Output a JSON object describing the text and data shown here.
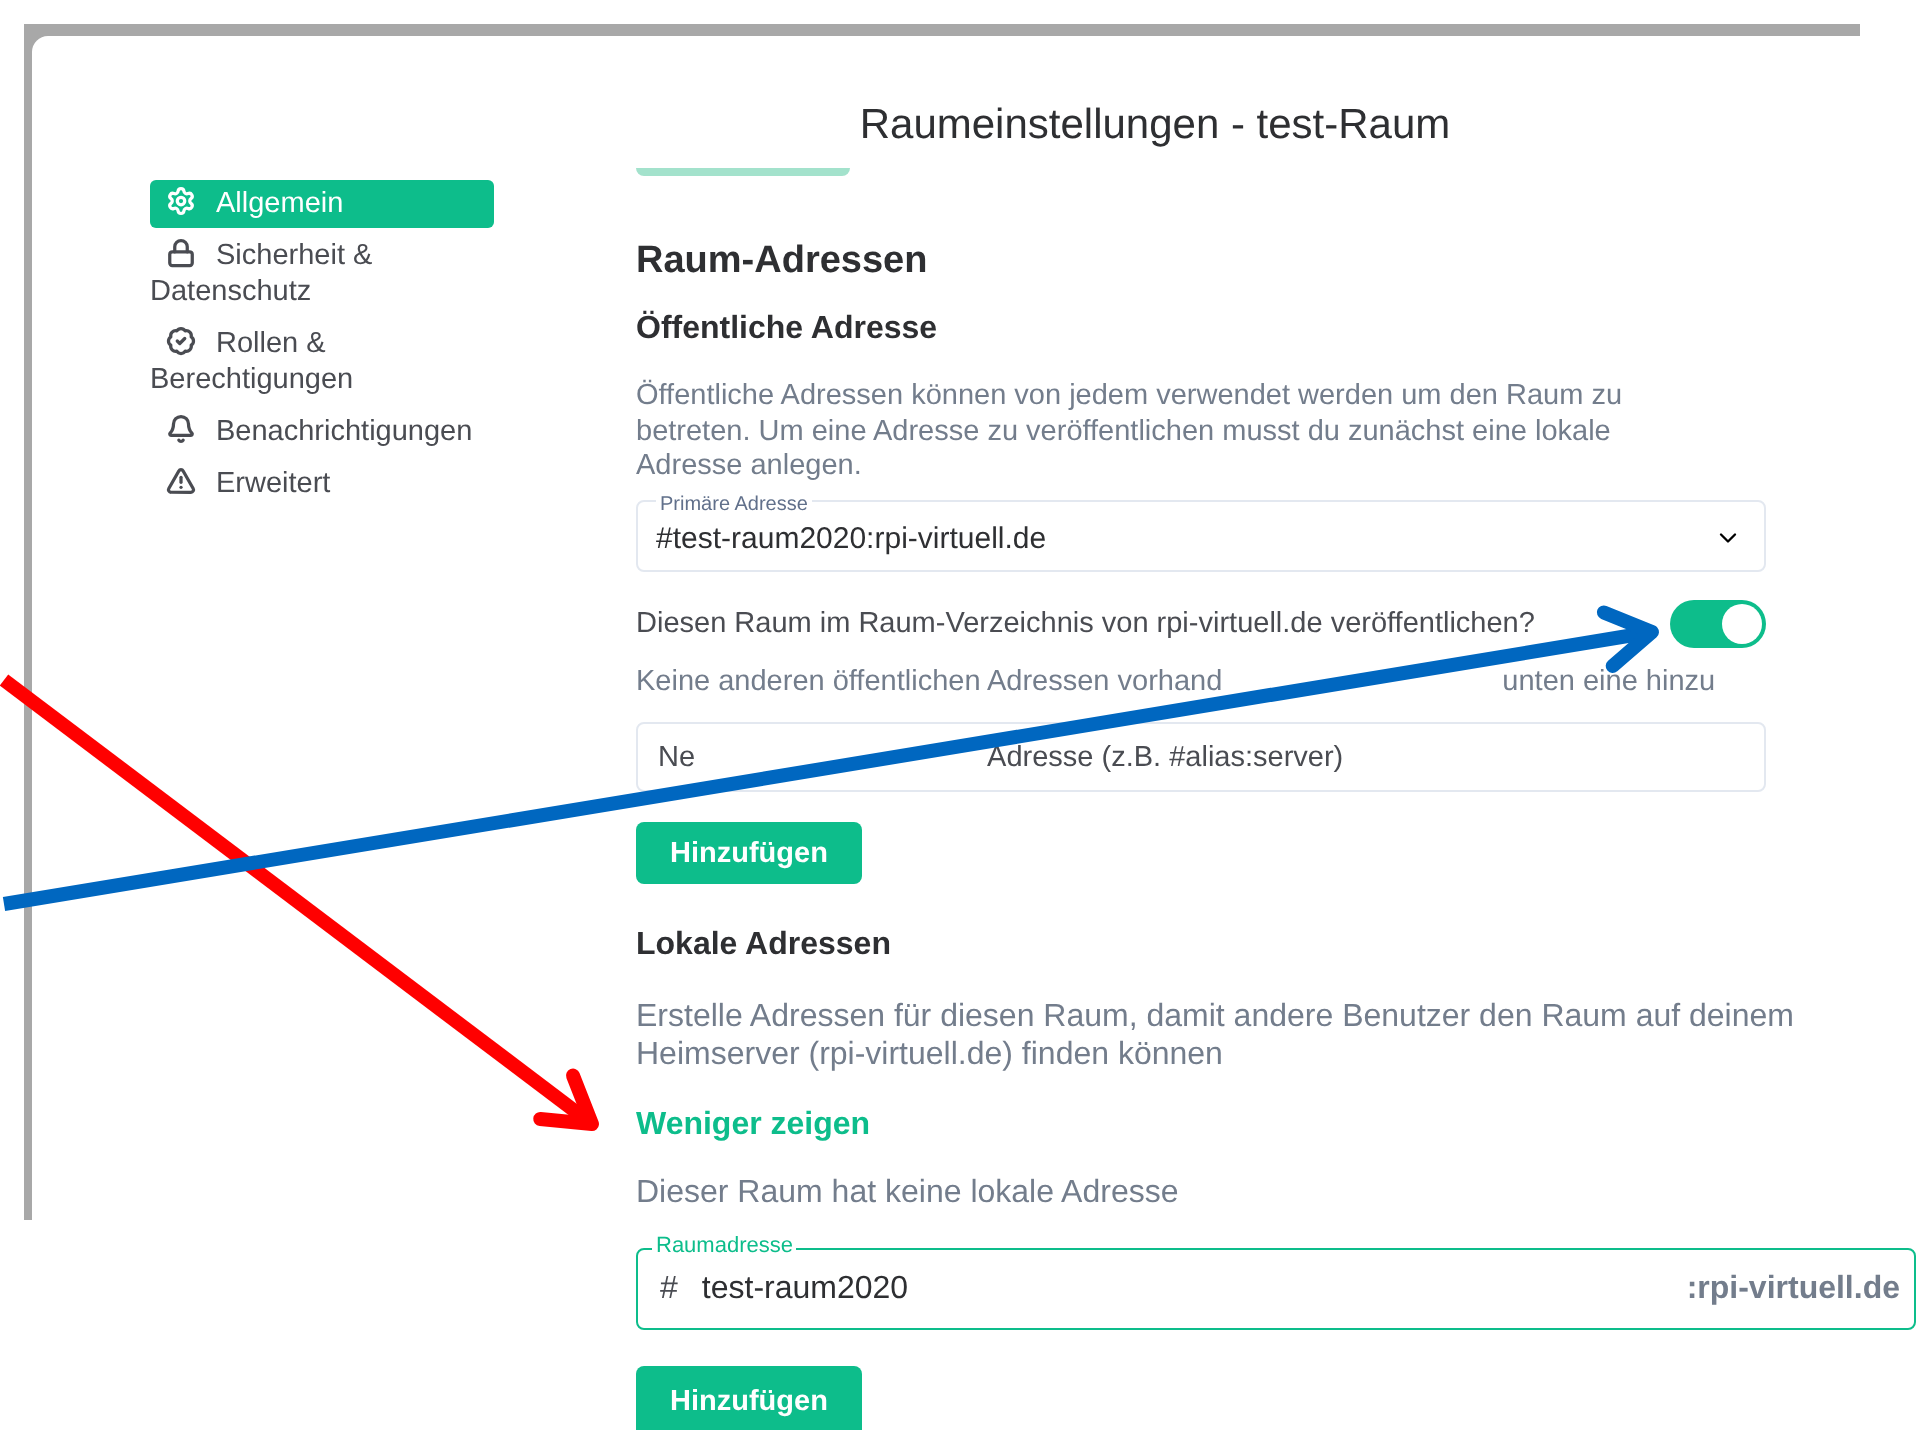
{
  "dialog": {
    "title": "Raumeinstellungen - test-Raum"
  },
  "sidebar": {
    "items": [
      {
        "label": "Allgemein",
        "selected": true
      },
      {
        "label": "Sicherheit & Datenschutz",
        "selected": false
      },
      {
        "label": "Rollen & Berechtigungen",
        "selected": false
      },
      {
        "label": "Benachrichtigungen",
        "selected": false
      },
      {
        "label": "Erweitert",
        "selected": false
      }
    ]
  },
  "section_title": "Raum-Adressen",
  "public": {
    "heading": "Öffentliche Adresse",
    "description": "Öffentliche Adressen können von jedem verwendet werden um den Raum zu betreten. Um eine Adresse zu veröffentlichen musst du zunächst eine lokale Adresse anlegen.",
    "primary_select": {
      "label": "Primäre Adresse",
      "value": "#test-raum2020:rpi-virtuell.de"
    },
    "publish_toggle": {
      "label": "Diesen Raum im Raum-Verzeichnis von rpi-virtuell.de veröffentlichen?",
      "on": true
    },
    "empty_note": [
      "Keine anderen öffentlichen Adressen vorhand",
      "unten eine hinzu"
    ],
    "new_address": {
      "placeholder": [
        "Ne",
        "Adresse (z.B. #alias:server)"
      ]
    },
    "add_button": "Hinzufügen"
  },
  "local": {
    "heading": "Lokale Adressen",
    "description": "Erstelle Adressen für diesen Raum, damit andere Benutzer den Raum auf deinem Heimserver (rpi-virtuell.de) finden können",
    "toggle_link": "Weniger zeigen",
    "empty_note": "Dieser Raum hat keine lokale Adresse",
    "address_field": {
      "label": "Raumadresse",
      "prefix": "#",
      "value": "test-raum2020",
      "suffix": ":rpi-virtuell.de"
    },
    "add_button": "Hinzufügen"
  },
  "annotations": [
    {
      "color": "#ff0000"
    },
    {
      "color": "#0067c0"
    }
  ]
}
